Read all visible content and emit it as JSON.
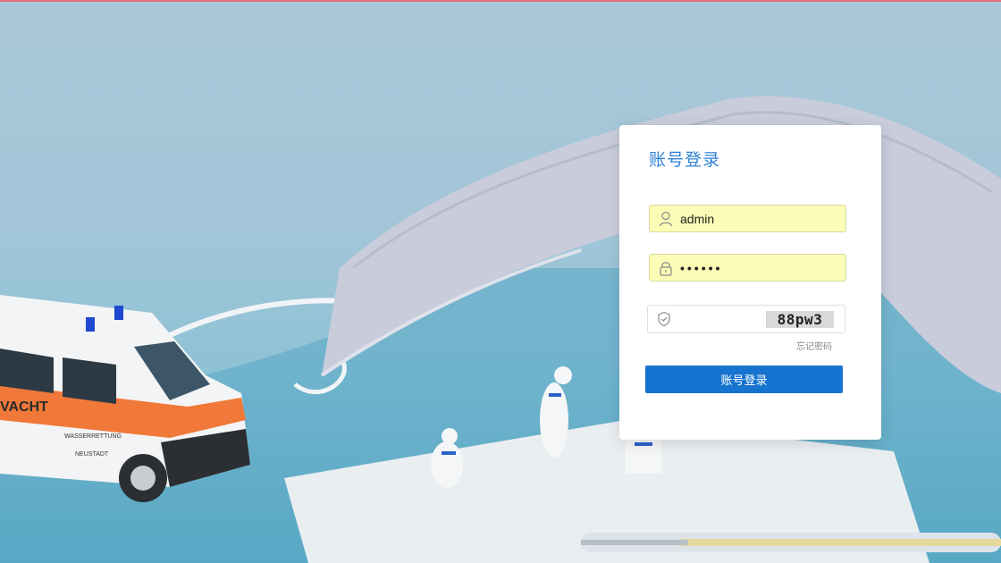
{
  "login": {
    "title": "账号登录",
    "username": {
      "value": "admin",
      "icon": "user-icon"
    },
    "password": {
      "value": "••••••",
      "icon": "lock-icon"
    },
    "captcha": {
      "value": "",
      "code": "88pw3",
      "icon": "shield-icon"
    },
    "forgot_label": "忘记密码",
    "submit_label": "账号登录"
  },
  "colors": {
    "accent": "#1673cf",
    "title": "#2f80d5",
    "autofill": "#fbfdb6",
    "top_accent": "#e86a7a"
  }
}
